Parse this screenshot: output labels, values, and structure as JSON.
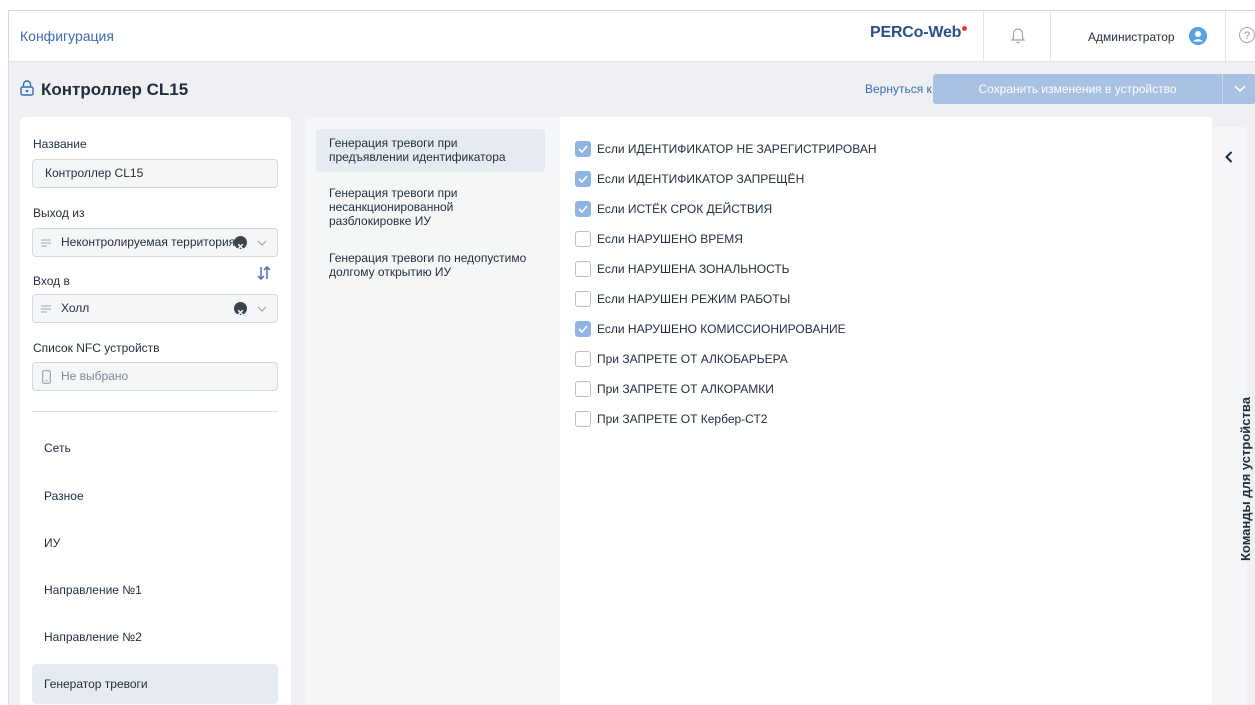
{
  "topbar": {
    "app_title": "Конфигурация",
    "logo": "PERCo-Web",
    "user_name": "Администратор",
    "help_label": "?"
  },
  "header": {
    "title": "Контроллер CL15",
    "back_link": "Вернуться к списку",
    "save_button": "Сохранить изменения в устройство"
  },
  "form": {
    "name_label": "Название",
    "name_value": "Контроллер CL15",
    "exit_label": "Выход из",
    "exit_value": "Неконтролируемая территория",
    "entry_label": "Вход в",
    "entry_value": "Холл",
    "nfc_label": "Список NFC устройств",
    "nfc_placeholder": "Не выбрано"
  },
  "nav": {
    "items": [
      {
        "label": "Сеть",
        "active": false
      },
      {
        "label": "Разное",
        "active": false
      },
      {
        "label": "ИУ",
        "active": false
      },
      {
        "label": "Направление №1",
        "active": false
      },
      {
        "label": "Направление №2",
        "active": false
      },
      {
        "label": "Генератор тревоги",
        "active": true
      }
    ]
  },
  "sections": {
    "items": [
      {
        "label": "Генерация тревоги при предъявлении идентификатора",
        "active": true
      },
      {
        "label": "Генерация тревоги при несанкционированной разблокировке ИУ",
        "active": false
      },
      {
        "label": "Генерация тревоги по недопустимо долгому открытию ИУ",
        "active": false
      }
    ]
  },
  "checkboxes": {
    "items": [
      {
        "label": "Если ИДЕНТИФИКАТОР НЕ ЗАРЕГИСТРИРОВАН",
        "checked": true
      },
      {
        "label": "Если ИДЕНТИФИКАТОР ЗАПРЕЩЁН",
        "checked": true
      },
      {
        "label": "Если ИСТЁК СРОК ДЕЙСТВИЯ",
        "checked": true
      },
      {
        "label": "Если НАРУШЕНО ВРЕМЯ",
        "checked": false
      },
      {
        "label": "Если НАРУШЕНА ЗОНАЛЬНОСТЬ",
        "checked": false
      },
      {
        "label": "Если НАРУШЕН РЕЖИМ РАБОТЫ",
        "checked": false
      },
      {
        "label": "Если НАРУШЕНО КОМИССИОНИРОВАНИЕ",
        "checked": true
      },
      {
        "label": "При ЗАПРЕТЕ ОТ АЛКОБАРЬЕРА",
        "checked": false
      },
      {
        "label": "При ЗАПРЕТЕ ОТ АЛКОРАМКИ",
        "checked": false
      },
      {
        "label": "При ЗАПРЕТЕ ОТ Кербер-СТ2",
        "checked": false
      }
    ]
  },
  "side": {
    "commands_label": "Команды для устройства"
  },
  "colors": {
    "accent": "#3a6db3",
    "checked": "#8fb3e2",
    "save_button": "#a9c2e3",
    "logo_dot": "#e53935"
  }
}
